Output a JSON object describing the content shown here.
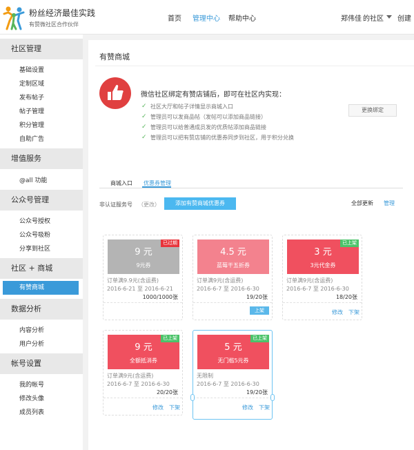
{
  "header": {
    "brand_title": "粉丝经济最佳实践",
    "brand_sub": "有赞微社区合作伙伴",
    "nav": [
      "首页",
      "管理中心",
      "帮助中心"
    ],
    "user": "郑伟佳",
    "community": "的社区",
    "create": "创建"
  },
  "sidebar": {
    "sections": [
      {
        "title": "社区管理",
        "items": [
          "基础设置",
          "定制区域",
          "发布帖子",
          "帖子管理",
          "积分管理",
          "自助广告"
        ]
      },
      {
        "title": "增值服务",
        "items": [
          "@all 功能"
        ]
      },
      {
        "title": "公众号管理",
        "items": [
          "公众号授权",
          "公众号吸粉",
          "分享到社区"
        ]
      },
      {
        "title": "社区 + 商城",
        "items": [
          "有赞商城"
        ]
      },
      {
        "title": "数据分析",
        "items": [
          "内容分析",
          "用户分析"
        ]
      },
      {
        "title": "帐号设置",
        "items": [
          "我的帐号",
          "修改头像",
          "成员列表"
        ]
      }
    ]
  },
  "main": {
    "title": "有赞商城",
    "intro": "微信社区绑定有赞店铺后，即可在社区内实现：",
    "bullets": [
      "社区大厅和帖子详情显示商城入口",
      "管理员可以发商品帖（发帖可以添加商品链接）",
      "管理员可以给普通成员发的优质帖添加商品链接",
      "管理员可以把有赞店铺的优惠券同步到社区，用于积分兑换"
    ],
    "change_binding": "更换绑定",
    "tabs": [
      "商城入口",
      "优惠券管理"
    ],
    "filter_label": "非认证服务号",
    "filter_link": "（更改）",
    "add_button": "添加有赞商城优惠券",
    "update_all": "全部更新",
    "manage": "管理"
  },
  "coupons": [
    {
      "amount": "9 元",
      "name": "9元券",
      "badge": "已过期",
      "condition": "订单满9.9元(含运费)",
      "dates": "2016-6-21 至 2016-6-21",
      "count": "1000/1000张",
      "color": "#b4b4b4",
      "badge_color": "#e8343b"
    },
    {
      "amount": "4.5 元",
      "name": "蓝莓干五折券",
      "badge": "",
      "condition": "订单满9元(含运费)",
      "dates": "2016-6-7 至 2016-6-30",
      "count": "19/20张",
      "color": "#f3828e",
      "badge_color": "",
      "tag": "上架"
    },
    {
      "amount": "3 元",
      "name": "3元代金券",
      "badge": "已上架",
      "condition": "订单满9元(含运费)",
      "dates": "2016-6-7 至 2016-6-30",
      "count": "18/20张",
      "color": "#f0505f",
      "badge_color": "#4cc36a",
      "edit": "修改",
      "down": "下架"
    },
    {
      "amount": "9 元",
      "name": "全额抵消券",
      "badge": "已上架",
      "condition": "订单满9元(含运费)",
      "dates": "2016-6-7 至 2016-6-30",
      "count": "20/20张",
      "color": "#f0505f",
      "badge_color": "#4cc36a",
      "edit": "修改",
      "down": "下架"
    },
    {
      "amount": "5 元",
      "name": "无门槛5元券",
      "badge": "已上架",
      "condition": "无限制",
      "dates": "2016-6-7 至 2016-6-30",
      "count": "19/20张",
      "color": "#f0505f",
      "badge_color": "#4cc36a",
      "edit": "修改",
      "down": "下架"
    }
  ]
}
